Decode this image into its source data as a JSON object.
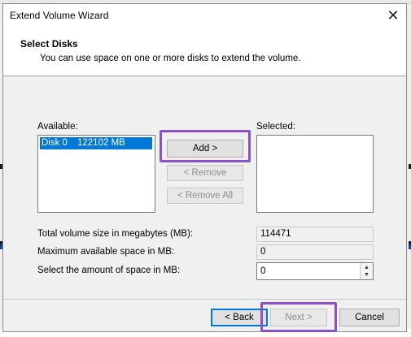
{
  "window": {
    "title": "Extend Volume Wizard"
  },
  "header": {
    "title": "Select Disks",
    "description": "You can use space on one or more disks to extend the volume."
  },
  "available": {
    "label": "Available:",
    "items": [
      {
        "name": "Disk 0",
        "size": "122102 MB",
        "selected": true
      }
    ]
  },
  "selected": {
    "label": "Selected:",
    "items": []
  },
  "buttons": {
    "add": "Add >",
    "remove": "< Remove",
    "remove_all": "< Remove All",
    "back": "< Back",
    "next": "Next >",
    "cancel": "Cancel"
  },
  "fields": {
    "total_label": "Total volume size in megabytes (MB):",
    "total_value": "114471",
    "max_label": "Maximum available space in MB:",
    "max_value": "0",
    "amount_label": "Select the amount of space in MB:",
    "amount_value": "0"
  },
  "colors": {
    "selection": "#0078d7",
    "highlight": "#8b52c6"
  }
}
